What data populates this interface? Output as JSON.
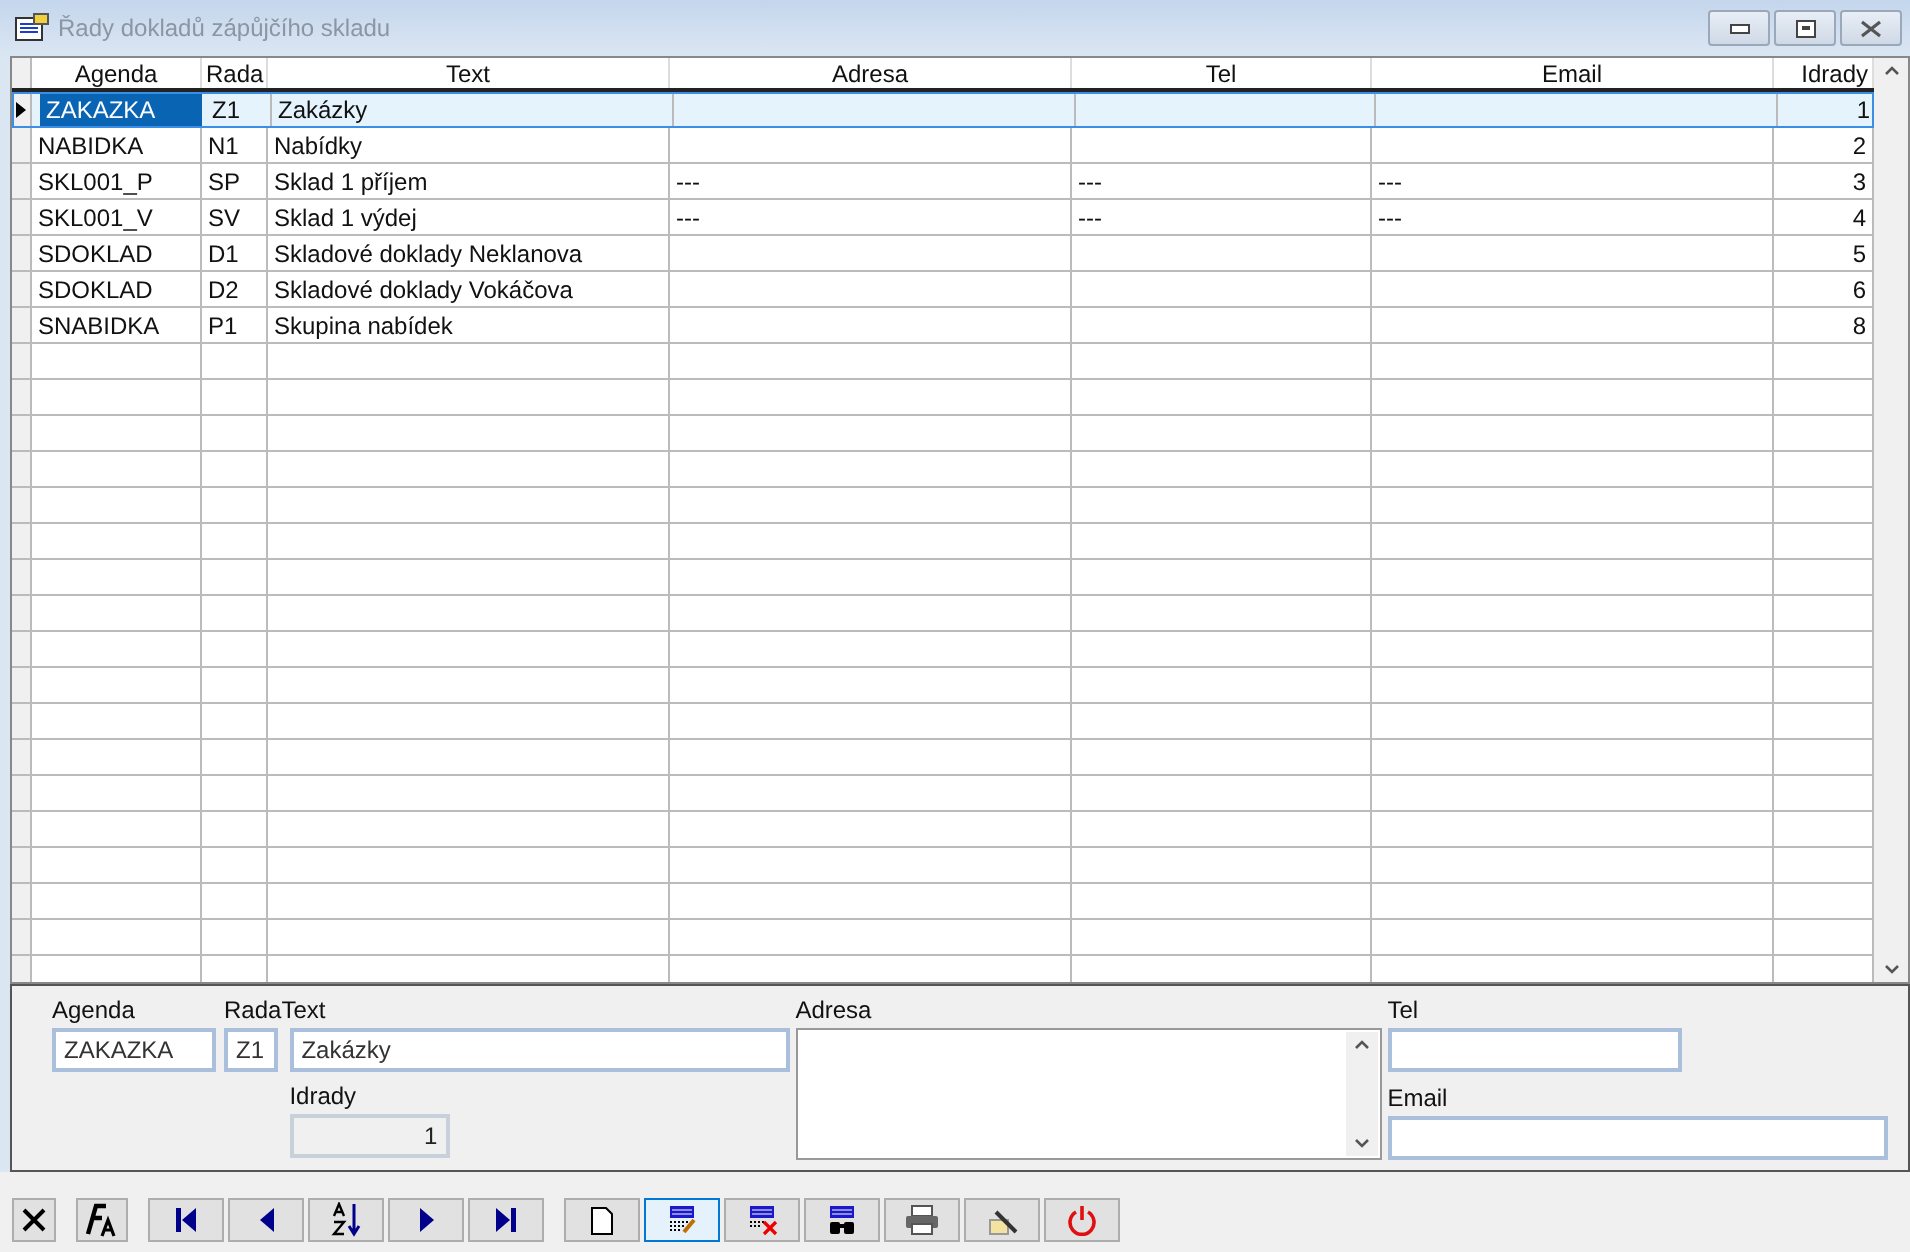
{
  "window": {
    "title": "Řady dokladů zápůjčího skladu"
  },
  "table": {
    "columns": [
      {
        "label": "Agenda"
      },
      {
        "label": "Rada"
      },
      {
        "label": "Text"
      },
      {
        "label": "Adresa"
      },
      {
        "label": "Tel"
      },
      {
        "label": "Email"
      },
      {
        "label": "Idrady"
      }
    ],
    "rows": [
      {
        "selected": true,
        "cells": [
          "ZAKAZKA",
          "Z1",
          "Zakázky",
          "",
          "",
          "",
          "1"
        ]
      },
      {
        "selected": false,
        "cells": [
          "NABIDKA",
          "N1",
          "Nabídky",
          "",
          "",
          "",
          "2"
        ]
      },
      {
        "selected": false,
        "cells": [
          "SKL001_P",
          "SP",
          "Sklad 1 příjem",
          "---",
          "---",
          "---",
          "3"
        ]
      },
      {
        "selected": false,
        "cells": [
          "SKL001_V",
          "SV",
          "Sklad 1 výdej",
          "---",
          "---",
          "---",
          "4"
        ]
      },
      {
        "selected": false,
        "cells": [
          "SDOKLAD",
          "D1",
          "Skladové doklady Neklanova",
          "",
          "",
          "",
          "5"
        ]
      },
      {
        "selected": false,
        "cells": [
          "SDOKLAD",
          "D2",
          "Skladové doklady Vokáčova",
          "",
          "",
          "",
          "6"
        ]
      },
      {
        "selected": false,
        "cells": [
          "SNABIDKA",
          "P1",
          "Skupina nabídek",
          "",
          "",
          "",
          "8"
        ]
      }
    ]
  },
  "form": {
    "agenda": {
      "label": "Agenda",
      "value": "ZAKAZKA"
    },
    "rada": {
      "label": "Rada",
      "value": "Z1"
    },
    "text": {
      "label": "Text",
      "value": "Zakázky"
    },
    "idrady": {
      "label": "Idrady",
      "value": "1",
      "disabled": true
    },
    "adresa": {
      "label": "Adresa"
    },
    "tel": {
      "label": "Tel"
    },
    "email": {
      "label": "Email"
    }
  },
  "toolbar": [
    {
      "kind": "cancel",
      "selected": false
    },
    {
      "kind": "font",
      "selected": false
    },
    {
      "kind": "first",
      "selected": false
    },
    {
      "kind": "prev",
      "selected": false
    },
    {
      "kind": "sort",
      "selected": false
    },
    {
      "kind": "next",
      "selected": false
    },
    {
      "kind": "last",
      "selected": false
    },
    {
      "kind": "new",
      "selected": false
    },
    {
      "kind": "edit",
      "selected": true
    },
    {
      "kind": "delete",
      "selected": false
    },
    {
      "kind": "find",
      "selected": false
    },
    {
      "kind": "print",
      "selected": false
    },
    {
      "kind": "tools",
      "selected": false
    },
    {
      "kind": "power",
      "selected": false
    }
  ]
}
